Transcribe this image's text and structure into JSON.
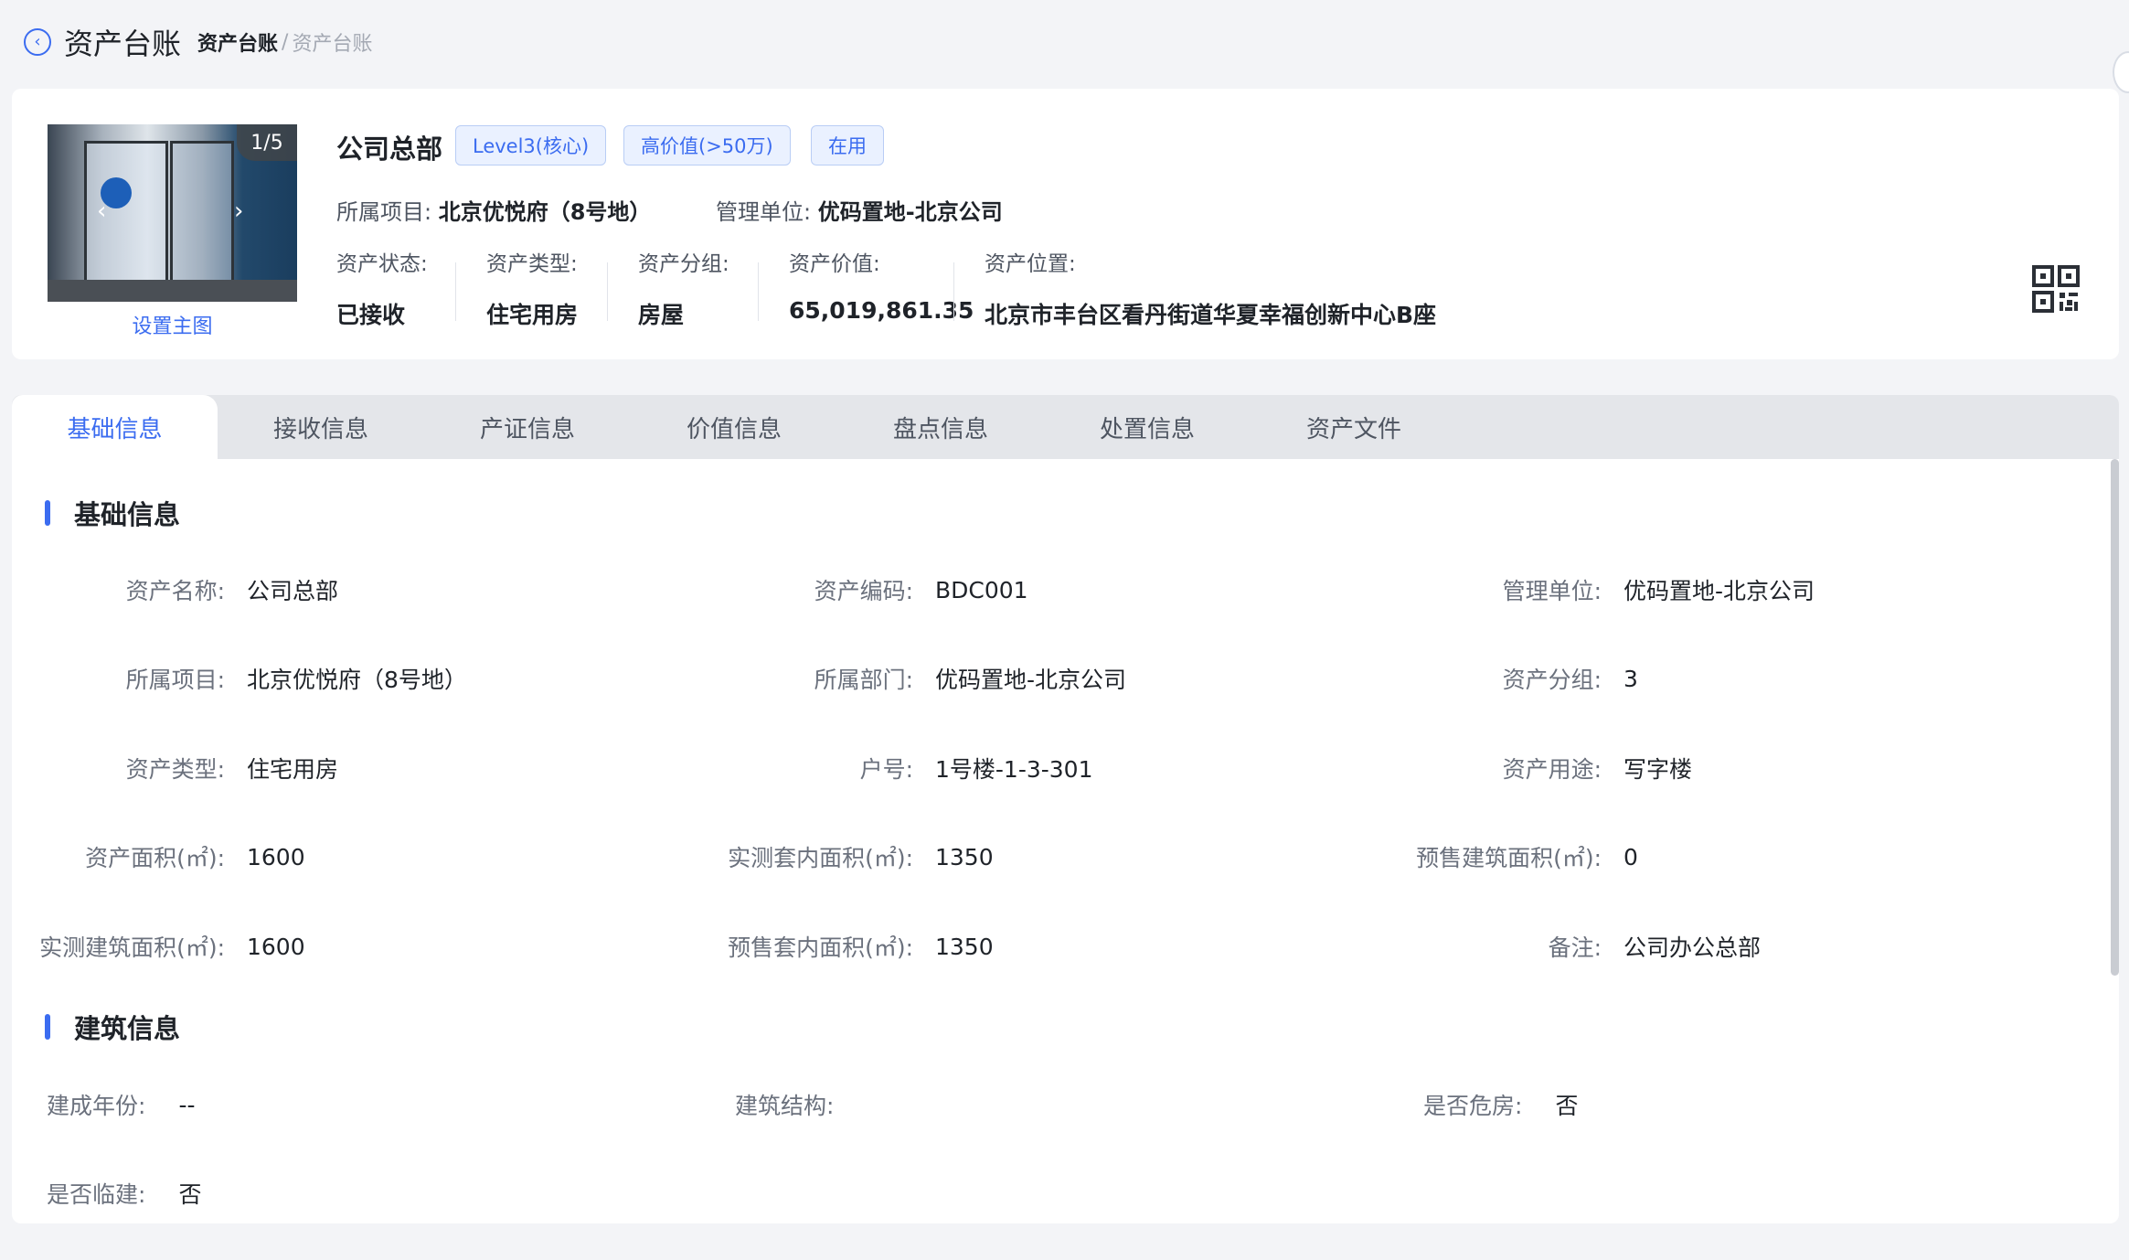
{
  "header": {
    "title": "资产台账",
    "breadcrumb": {
      "current": "资产台账",
      "separator": "/",
      "last": "资产台账"
    }
  },
  "summary": {
    "photo_counter": "1/5",
    "set_main_label": "设置主图",
    "name": "公司总部",
    "tags": [
      "Level3(核心)",
      "高价值(>50万)",
      "在用"
    ],
    "project_label": "所属项目:",
    "project_value": "北京优悦府（8号地）",
    "unit_label": "管理单位:",
    "unit_value": "优码置地-北京公司",
    "stats": {
      "status": {
        "label": "资产状态:",
        "value": "已接收"
      },
      "type": {
        "label": "资产类型:",
        "value": "住宅用房"
      },
      "group": {
        "label": "资产分组:",
        "value": "房屋"
      },
      "value": {
        "label": "资产价值:",
        "value": "65,019,861.35"
      },
      "location": {
        "label": "资产位置:",
        "value": "北京市丰台区看丹街道华夏幸福创新中心B座"
      }
    }
  },
  "tabs": [
    "基础信息",
    "接收信息",
    "产证信息",
    "价值信息",
    "盘点信息",
    "处置信息",
    "资产文件"
  ],
  "basic": {
    "title": "基础信息",
    "fields": [
      {
        "label": "资产名称:",
        "value": "公司总部"
      },
      {
        "label": "资产编码:",
        "value": "BDC001"
      },
      {
        "label": "管理单位:",
        "value": "优码置地-北京公司"
      },
      {
        "label": "所属项目:",
        "value": "北京优悦府（8号地）"
      },
      {
        "label": "所属部门:",
        "value": "优码置地-北京公司"
      },
      {
        "label": "资产分组:",
        "value": "3"
      },
      {
        "label": "资产类型:",
        "value": "住宅用房"
      },
      {
        "label": "户号:",
        "value": "1号楼-1-3-301"
      },
      {
        "label": "资产用途:",
        "value": "写字楼"
      },
      {
        "label": "资产面积(㎡):",
        "value": "1600"
      },
      {
        "label": "实测套内面积(㎡):",
        "value": "1350"
      },
      {
        "label": "预售建筑面积(㎡):",
        "value": "0"
      },
      {
        "label": "实测建筑面积(㎡):",
        "value": "1600"
      },
      {
        "label": "预售套内面积(㎡):",
        "value": "1350"
      },
      {
        "label": "备注:",
        "value": "公司办公总部"
      }
    ]
  },
  "building": {
    "title": "建筑信息",
    "fields": [
      {
        "label": "建成年份:",
        "value": "--"
      },
      {
        "label": "建筑结构:",
        "value": ""
      },
      {
        "label": "是否危房:",
        "value": "否"
      },
      {
        "label": "是否临建:",
        "value": "否"
      }
    ]
  },
  "colors": {
    "accent": "#3b6cf0",
    "tag_bg": "#eaf1ff",
    "page_bg": "#f3f4f7"
  }
}
